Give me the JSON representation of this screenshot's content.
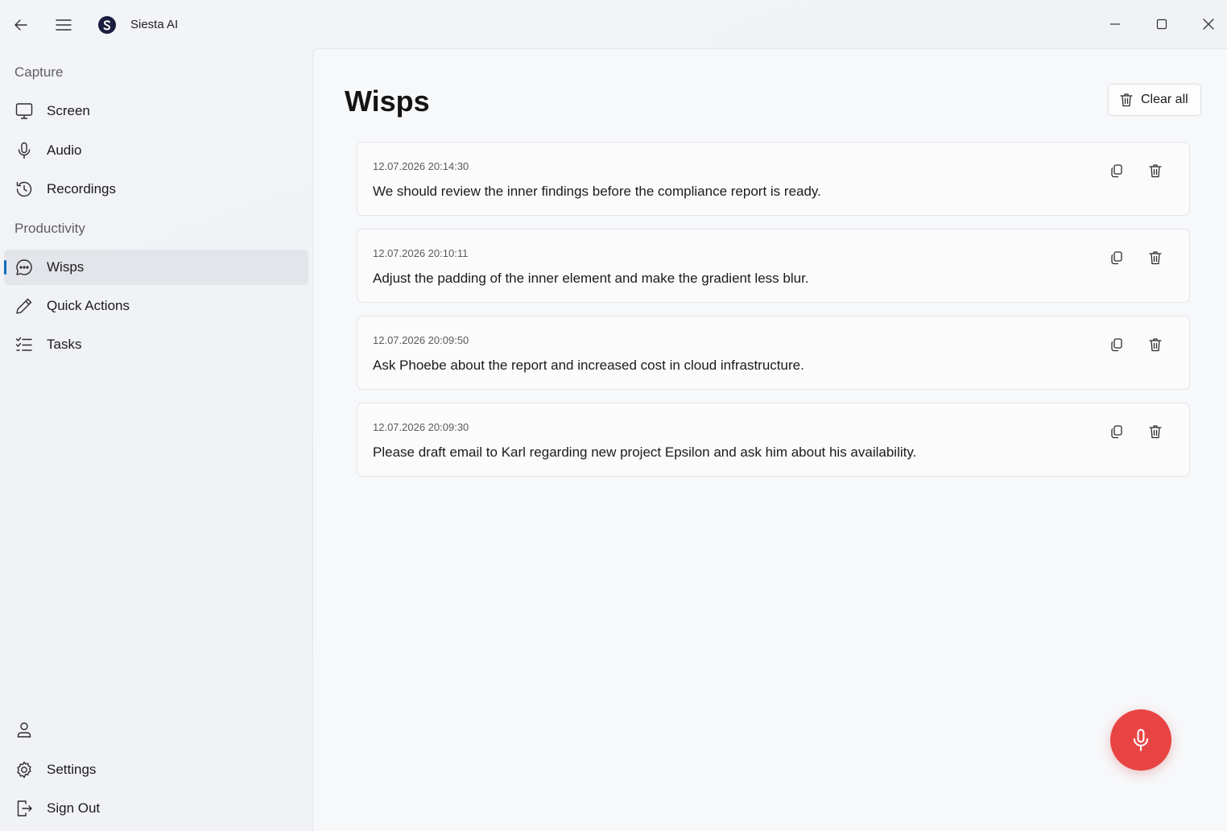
{
  "app": {
    "title": "Siesta AI"
  },
  "titlebar": {
    "icons": [
      "arrow-left-icon",
      "hamburger-menu-icon",
      "minimize-icon",
      "maximize-icon",
      "close-icon"
    ]
  },
  "sidebar": {
    "sections": [
      {
        "header": "Capture",
        "items": [
          {
            "label": "Screen",
            "icon": "monitor-icon"
          },
          {
            "label": "Audio",
            "icon": "microphone-icon"
          },
          {
            "label": "Recordings",
            "icon": "history-icon"
          }
        ]
      },
      {
        "header": "Productivity",
        "items": [
          {
            "label": "Wisps",
            "icon": "chat-bubble-icon",
            "active": true
          },
          {
            "label": "Quick Actions",
            "icon": "pencil-icon"
          },
          {
            "label": "Tasks",
            "icon": "checklist-icon"
          }
        ]
      }
    ],
    "footer": {
      "account_icon": "person-icon",
      "settings_label": "Settings",
      "signout_label": "Sign Out"
    }
  },
  "main": {
    "title": "Wisps",
    "clear_all_label": "Clear all",
    "wisps": [
      {
        "timestamp": "12.07.2026 20:14:30",
        "text": "We should review the inner findings before the compliance report is ready."
      },
      {
        "timestamp": "12.07.2026 20:10:11",
        "text": "Adjust the padding of the inner element and make the gradient less blur."
      },
      {
        "timestamp": "12.07.2026 20:09:50",
        "text": "Ask Phoebe about the report and increased cost in cloud infrastructure."
      },
      {
        "timestamp": "12.07.2026 20:09:30",
        "text": "Please draft email to Karl regarding new project Epsilon and ask him about his availability."
      }
    ]
  },
  "colors": {
    "accent": "#0f6cbd",
    "record_button": "#e94444",
    "logo": "#1b1e3d"
  }
}
